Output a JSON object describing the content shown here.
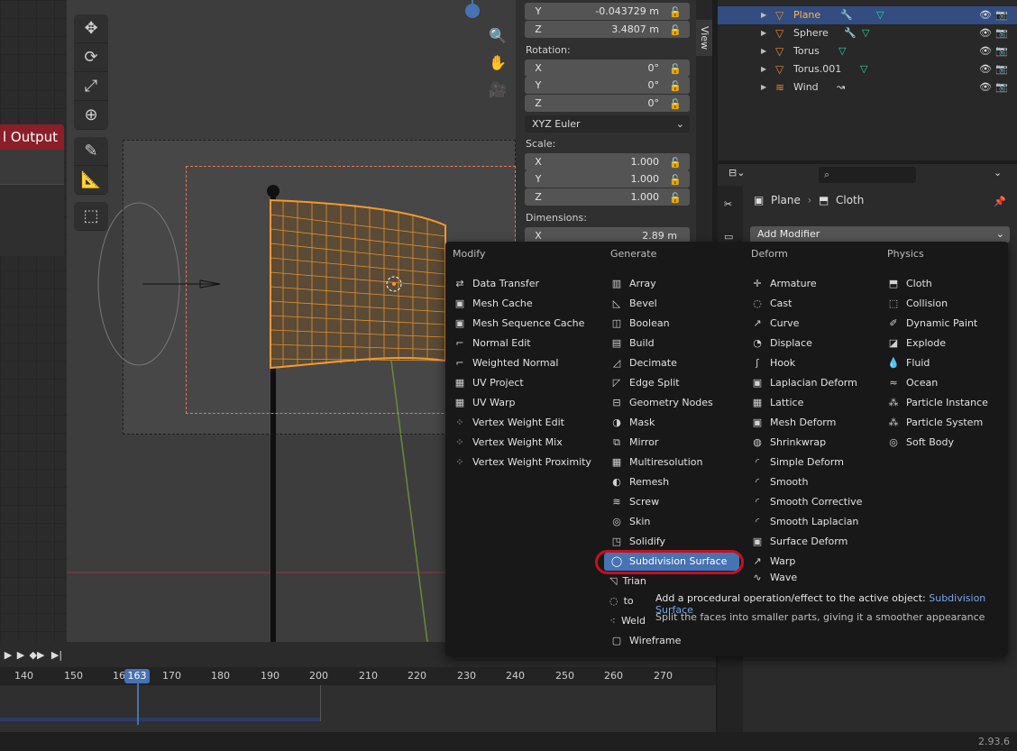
{
  "node_editor": {
    "node_title": "l Output"
  },
  "npanel": {
    "location": [
      {
        "axis": "Y",
        "value": "-0.043729 m"
      },
      {
        "axis": "Z",
        "value": "3.4807 m"
      }
    ],
    "rotation_label": "Rotation:",
    "rotation": [
      {
        "axis": "X",
        "value": "0°"
      },
      {
        "axis": "Y",
        "value": "0°"
      },
      {
        "axis": "Z",
        "value": "0°"
      }
    ],
    "rotation_mode": "XYZ Euler",
    "scale_label": "Scale:",
    "scale": [
      {
        "axis": "X",
        "value": "1.000"
      },
      {
        "axis": "Y",
        "value": "1.000"
      },
      {
        "axis": "Z",
        "value": "1.000"
      }
    ],
    "dimensions_label": "Dimensions:",
    "dimensions": [
      {
        "axis": "X",
        "value": "2.89 m"
      }
    ],
    "tab_view": "View"
  },
  "outliner": {
    "rows": [
      {
        "name": "Plane",
        "selected": true
      },
      {
        "name": "Sphere",
        "selected": false
      },
      {
        "name": "Torus",
        "selected": false
      },
      {
        "name": "Torus.001",
        "selected": false
      },
      {
        "name": "Wind",
        "selected": false
      }
    ]
  },
  "properties": {
    "search_placeholder": "",
    "breadcrumb_object": "Plane",
    "breadcrumb_modifier": "Cloth",
    "add_modifier_label": "Add Modifier"
  },
  "menu": {
    "columns": [
      {
        "header": "Modify",
        "items": [
          "Data Transfer",
          "Mesh Cache",
          "Mesh Sequence Cache",
          "Normal Edit",
          "Weighted Normal",
          "UV Project",
          "UV Warp",
          "Vertex Weight Edit",
          "Vertex Weight Mix",
          "Vertex Weight Proximity"
        ]
      },
      {
        "header": "Generate",
        "items": [
          "Array",
          "Bevel",
          "Boolean",
          "Build",
          "Decimate",
          "Edge Split",
          "Geometry Nodes",
          "Mask",
          "Mirror",
          "Multiresolution",
          "Remesh",
          "Screw",
          "Skin",
          "Solidify",
          "Subdivision Surface",
          "Triangulate",
          "Volume to Mesh",
          "Weld",
          "Wireframe"
        ]
      },
      {
        "header": "Deform",
        "items": [
          "Armature",
          "Cast",
          "Curve",
          "Displace",
          "Hook",
          "Laplacian Deform",
          "Lattice",
          "Mesh Deform",
          "Shrinkwrap",
          "Simple Deform",
          "Smooth",
          "Smooth Corrective",
          "Smooth Laplacian",
          "Surface Deform",
          "Warp",
          "Wave"
        ]
      },
      {
        "header": "Physics",
        "items": [
          "Cloth",
          "Collision",
          "Dynamic Paint",
          "Explode",
          "Fluid",
          "Ocean",
          "Particle Instance",
          "Particle System",
          "Soft Body"
        ]
      }
    ],
    "highlighted": "Subdivision Surface"
  },
  "tooltip": {
    "line1_prefix": "Add a procedural operation/effect to the active object:",
    "line1_highlight": "Subdivision Surface",
    "line2": "Split the faces into smaller parts, giving it a smoother appearance"
  },
  "timeline": {
    "ticks": [
      "140",
      "150",
      "16",
      "170",
      "180",
      "190",
      "200",
      "210",
      "220",
      "230",
      "240",
      "250",
      "260",
      "270"
    ],
    "current_frame": "163"
  },
  "status": {
    "version": "2.93.6"
  },
  "colors": {
    "accent": "#4772b3",
    "object_orange": "#e5893a",
    "highlight_ring": "#c1121f"
  }
}
